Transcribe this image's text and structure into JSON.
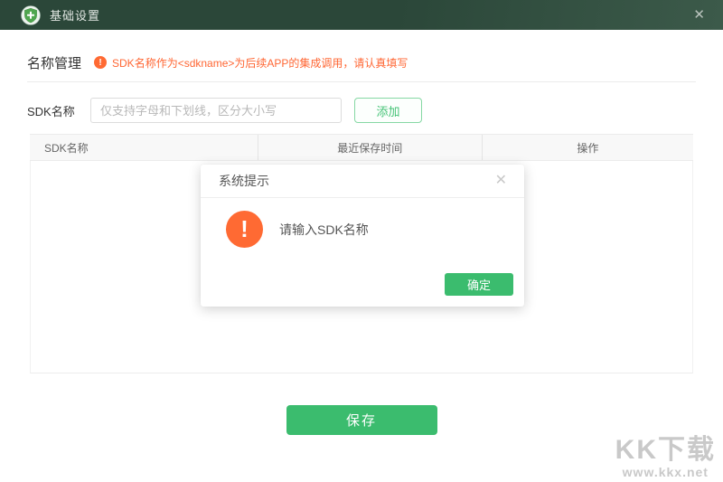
{
  "window": {
    "title": "基础设置",
    "close_glyph": "✕"
  },
  "section": {
    "title": "名称管理",
    "notice_glyph": "!",
    "notice": "SDK名称作为<sdkname>为后续APP的集成调用，请认真填写"
  },
  "form": {
    "label": "SDK名称",
    "placeholder": "仅支持字母和下划线，区分大小写",
    "value": "",
    "add_label": "添加"
  },
  "table": {
    "headers": [
      "SDK名称",
      "最近保存时间",
      "操作"
    ],
    "rows": []
  },
  "dialog": {
    "title": "系统提示",
    "icon_glyph": "!",
    "message": "请输入SDK名称",
    "confirm_label": "确定",
    "close_glyph": "✕"
  },
  "footer": {
    "save_label": "保存"
  },
  "watermark": {
    "logo": "KK下载",
    "url": "www.kkx.net"
  },
  "colors": {
    "titlebar_green": "#2b4739",
    "accent_green": "#3bbc6e",
    "warning_orange": "#ff6a33",
    "notice_text_orange": "#ff6633",
    "header_gray": "#f8f8f8"
  }
}
